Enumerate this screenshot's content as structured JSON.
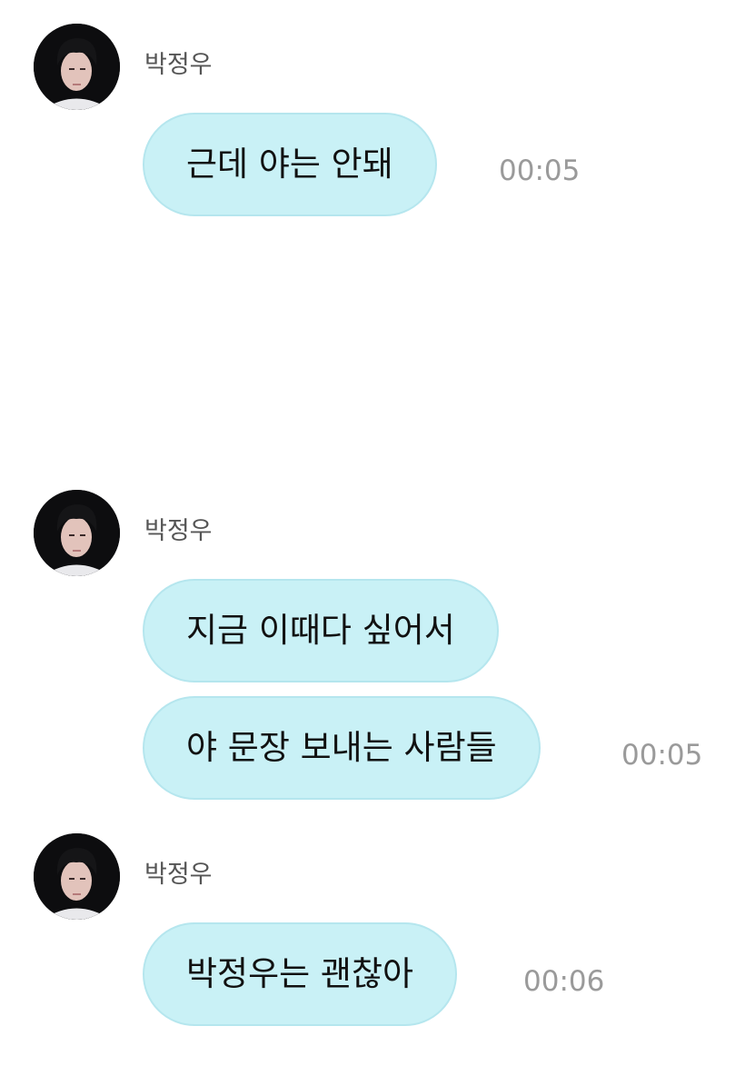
{
  "chat": {
    "groups": [
      {
        "sender": "박정우",
        "avatar": "profile-photo",
        "messages": [
          {
            "text": "근데 야는 안돼",
            "time": "00:05"
          }
        ]
      },
      {
        "sender": "박정우",
        "avatar": "profile-photo",
        "messages": [
          {
            "text": "지금 이때다 싶어서",
            "time": ""
          },
          {
            "text": "야 문장 보내는 사람들",
            "time": "00:05"
          }
        ]
      },
      {
        "sender": "박정우",
        "avatar": "profile-photo",
        "messages": [
          {
            "text": "박정우는 괜찮아",
            "time": "00:06"
          }
        ]
      }
    ]
  },
  "colors": {
    "bubble": "#c9f1f6",
    "bubble_border": "#b5e6ee",
    "sender_text": "#555555",
    "time_text": "#9a9a9a",
    "background": "#ffffff"
  }
}
